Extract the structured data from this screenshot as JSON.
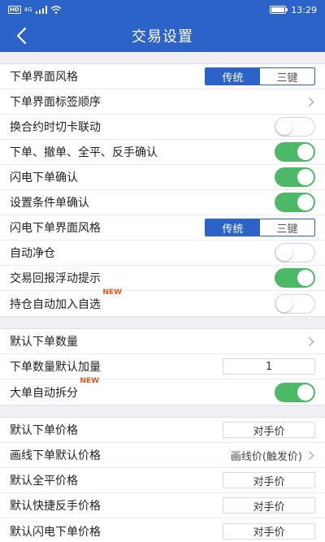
{
  "status_bar": {
    "network": "HD",
    "signal_label": "4G",
    "time": "13:29"
  },
  "nav": {
    "title": "交易设置"
  },
  "sections": {
    "s1": {
      "order_ui_style": {
        "label": "下单界面风格",
        "options": [
          "传统",
          "三键"
        ],
        "selected": "传统"
      },
      "order_tab_order": {
        "label": "下单界面标签顺序"
      },
      "contract_link": {
        "label": "换合约时切卡联动",
        "enabled": false
      },
      "confirm_actions": {
        "label": "下单、撤单、全平、反手确认",
        "enabled": true
      },
      "flash_confirm": {
        "label": "闪电下单确认",
        "enabled": true
      },
      "condition_confirm": {
        "label": "设置条件单确认",
        "enabled": true
      },
      "flash_ui_style": {
        "label": "闪电下单界面风格",
        "options": [
          "传统",
          "三键"
        ],
        "selected": "传统"
      },
      "auto_net": {
        "label": "自动净仓",
        "enabled": false
      },
      "float_tip": {
        "label": "交易回报浮动提示",
        "enabled": true
      },
      "auto_watch": {
        "label": "持仓自动加入自选",
        "badge": "NEW",
        "enabled": false
      }
    },
    "s2": {
      "default_qty": {
        "label": "默认下单数量"
      },
      "qty_step": {
        "label": "下单数量默认加量",
        "value": "1"
      },
      "auto_split": {
        "label": "大单自动拆分",
        "badge": "NEW",
        "enabled": true
      }
    },
    "s3": {
      "default_price": {
        "label": "默认下单价格",
        "value": "对手价"
      },
      "line_price": {
        "label": "画线下单默认价格",
        "value": "画线价(触发价)"
      },
      "close_price": {
        "label": "默认全平价格",
        "value": "对手价"
      },
      "reverse_price": {
        "label": "默认快捷反手价格",
        "value": "对手价"
      },
      "flash_price": {
        "label": "默认闪电下单价格",
        "value": "对手价"
      }
    }
  },
  "colors": {
    "primary": "#2b63c9",
    "toggle_on": "#4cb966",
    "badge": "#e8541e"
  }
}
